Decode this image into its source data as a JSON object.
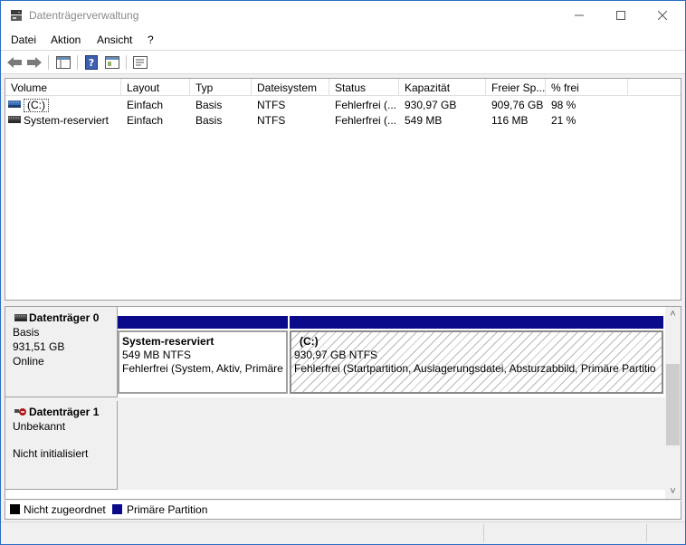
{
  "window": {
    "title": "Datenträgerverwaltung",
    "minimize_glyph": "—",
    "maximize_glyph": "☐",
    "close_glyph": "✕"
  },
  "menu": [
    {
      "label": "Datei"
    },
    {
      "label": "Aktion"
    },
    {
      "label": "Ansicht"
    },
    {
      "label": "?"
    }
  ],
  "toolbar": {
    "icons": [
      "back-icon",
      "forward-icon",
      "properties-pane-icon",
      "help-icon",
      "console-view-icon",
      "settings-list-icon"
    ]
  },
  "volume_list": {
    "columns": [
      "Volume",
      "Layout",
      "Typ",
      "Dateisystem",
      "Status",
      "Kapazität",
      "Freier Sp...",
      "% frei"
    ],
    "rows": [
      {
        "volume": "(C:)",
        "layout": "Einfach",
        "typ": "Basis",
        "dateisystem": "NTFS",
        "status": "Fehlerfrei (...",
        "kapazitaet": "930,97 GB",
        "frei": "909,76 GB",
        "prozent": "98 %"
      },
      {
        "volume": "System-reserviert",
        "layout": "Einfach",
        "typ": "Basis",
        "dateisystem": "NTFS",
        "status": "Fehlerfrei (...",
        "kapazitaet": "549 MB",
        "frei": "116 MB",
        "prozent": "21 %"
      }
    ]
  },
  "disks": [
    {
      "name": "Datenträger 0",
      "type": "Basis",
      "size": "931,51 GB",
      "state": "Online",
      "partitions": [
        {
          "name": "System-reserviert",
          "size": "549 MB NTFS",
          "status": "Fehlerfrei (System, Aktiv, Primäre"
        },
        {
          "name": "(C:)",
          "size": "930,97 GB NTFS",
          "status": "Fehlerfrei (Startpartition, Auslagerungsdatei, Absturzabbild, Primäre Partitio"
        }
      ]
    },
    {
      "name": "Datenträger 1",
      "type": "Unbekannt",
      "size": "",
      "state": "Nicht initialisiert",
      "partitions": []
    }
  ],
  "legend": [
    {
      "label": "Nicht zugeordnet",
      "color": "#000000"
    },
    {
      "label": "Primäre Partition",
      "color": "#0a0a8a"
    }
  ],
  "colors": {
    "accent": "#2b6cc4",
    "partition_bar": "#0a0a8a"
  },
  "scrollbar": {
    "up_glyph": "˄",
    "down_glyph": "˅"
  }
}
